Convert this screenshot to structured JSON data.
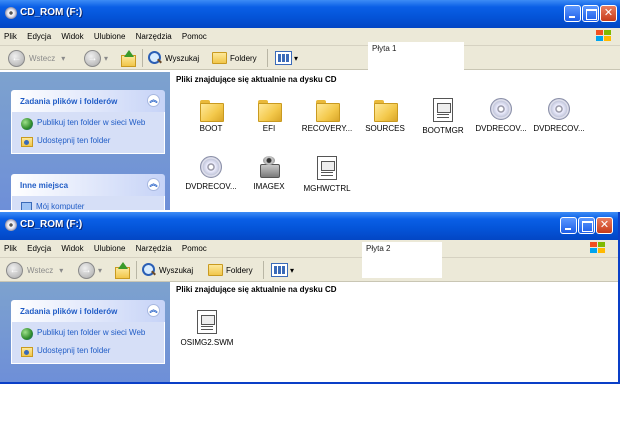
{
  "window1": {
    "title": "CD_ROM (F:)",
    "menu": [
      "Plik",
      "Edycja",
      "Widok",
      "Ulubione",
      "Narzędzia",
      "Pomoc"
    ],
    "toolbar": {
      "back": "Wstecz",
      "search": "Wyszukaj",
      "folders": "Foldery"
    },
    "label": "Płyta 1",
    "heading": "Pliki znajdujące się aktualnie na dysku CD",
    "tasks_title": "Zadania plików i folderów",
    "tasks": [
      "Publikuj ten folder w sieci Web",
      "Udostępnij ten folder"
    ],
    "places_title": "Inne miejsca",
    "places_item": "Mój komputer",
    "items": [
      {
        "name": "BOOT",
        "icon": "folder-icon"
      },
      {
        "name": "EFI",
        "icon": "folder-icon"
      },
      {
        "name": "RECOVERY...",
        "icon": "folder-icon"
      },
      {
        "name": "SOURCES",
        "icon": "folder-icon"
      },
      {
        "name": "BOOTMGR",
        "icon": "file-icon"
      },
      {
        "name": "DVDRECOV...",
        "icon": "disc-icon"
      },
      {
        "name": "DVDRECOV...",
        "icon": "disc-icon"
      },
      {
        "name": "DVDRECOV...",
        "icon": "disc-icon"
      },
      {
        "name": "IMAGEX",
        "icon": "imagex-icon"
      },
      {
        "name": "MGHWCTRL",
        "icon": "file-icon"
      }
    ]
  },
  "window2": {
    "title": "CD_ROM (F:)",
    "menu": [
      "Plik",
      "Edycja",
      "Widok",
      "Ulubione",
      "Narzędzia",
      "Pomoc"
    ],
    "toolbar": {
      "back": "Wstecz",
      "search": "Wyszukaj",
      "folders": "Foldery"
    },
    "label": "Płyta 2",
    "heading": "Pliki znajdujące się aktualnie na dysku CD",
    "tasks_title": "Zadania plików i folderów",
    "tasks": [
      "Publikuj ten folder w sieci Web",
      "Udostępnij ten folder"
    ],
    "items": [
      {
        "name": "OSIMG2.SWM",
        "icon": "file-icon"
      }
    ]
  },
  "colors": {
    "titlebar": "#0454d8",
    "sidebar": "#6e8fd8",
    "link": "#215dc6"
  }
}
